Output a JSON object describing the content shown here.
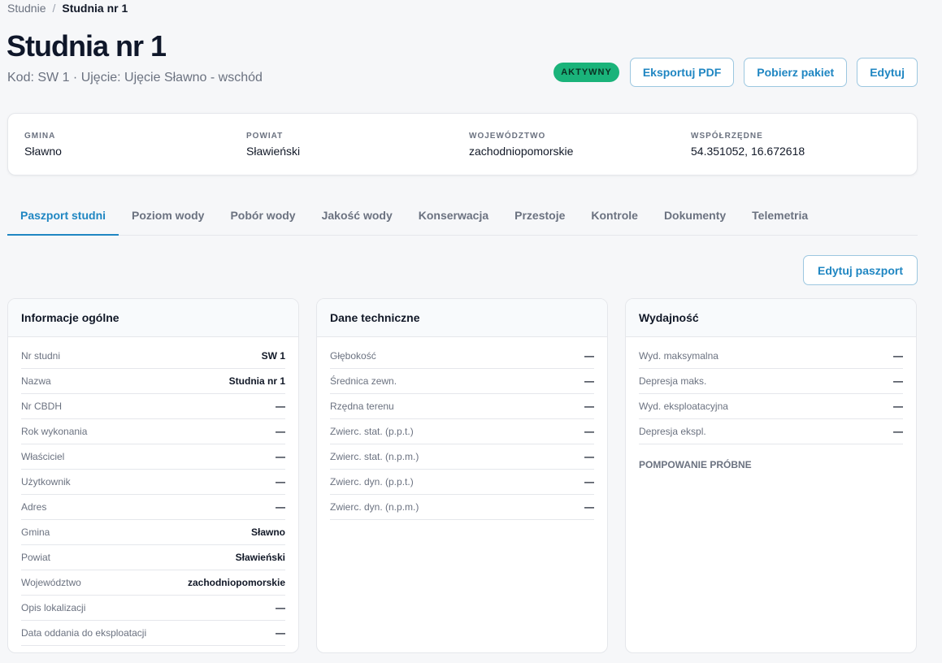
{
  "breadcrumb": {
    "parent": "Studnie",
    "separator": "/",
    "current": "Studnia nr 1"
  },
  "header": {
    "title": "Studnia nr 1",
    "subtitle": "Kod: SW 1 · Ujęcie: Ujęcie Sławno - wschód",
    "status_badge": "AKTYWNY",
    "buttons": {
      "export_pdf": "Eksportuj PDF",
      "download_package": "Pobierz pakiet",
      "edit": "Edytuj"
    }
  },
  "location": [
    {
      "label": "GMINA",
      "value": "Sławno"
    },
    {
      "label": "POWIAT",
      "value": "Sławieński"
    },
    {
      "label": "WOJEWÓDZTWO",
      "value": "zachodniopomorskie"
    },
    {
      "label": "WSPÓŁRZĘDNE",
      "value": "54.351052, 16.672618"
    }
  ],
  "tabs": [
    "Paszport studni",
    "Poziom wody",
    "Pobór wody",
    "Jakość wody",
    "Konserwacja",
    "Przestoje",
    "Kontrole",
    "Dokumenty",
    "Telemetria"
  ],
  "edit_passport_label": "Edytuj paszport",
  "panels": {
    "general": {
      "title": "Informacje ogólne",
      "rows": [
        {
          "k": "Nr studni",
          "v": "SW 1"
        },
        {
          "k": "Nazwa",
          "v": "Studnia nr 1"
        },
        {
          "k": "Nr CBDH",
          "v": "—"
        },
        {
          "k": "Rok wykonania",
          "v": "—"
        },
        {
          "k": "Właściciel",
          "v": "—"
        },
        {
          "k": "Użytkownik",
          "v": "—"
        },
        {
          "k": "Adres",
          "v": "—"
        },
        {
          "k": "Gmina",
          "v": "Sławno"
        },
        {
          "k": "Powiat",
          "v": "Sławieński"
        },
        {
          "k": "Województwo",
          "v": "zachodniopomorskie"
        },
        {
          "k": "Opis lokalizacji",
          "v": "—"
        },
        {
          "k": "Data oddania do eksploatacji",
          "v": "—"
        }
      ]
    },
    "technical": {
      "title": "Dane techniczne",
      "rows": [
        {
          "k": "Głębokość",
          "v": "—"
        },
        {
          "k": "Średnica zewn.",
          "v": "—"
        },
        {
          "k": "Rzędna terenu",
          "v": "—"
        },
        {
          "k": "Zwierc. stat. (p.p.t.)",
          "v": "—"
        },
        {
          "k": "Zwierc. stat. (n.p.m.)",
          "v": "—"
        },
        {
          "k": "Zwierc. dyn. (p.p.t.)",
          "v": "—"
        },
        {
          "k": "Zwierc. dyn. (n.p.m.)",
          "v": "—"
        }
      ]
    },
    "efficiency": {
      "title": "Wydajność",
      "rows": [
        {
          "k": "Wyd. maksymalna",
          "v": "—"
        },
        {
          "k": "Depresja maks.",
          "v": "—"
        },
        {
          "k": "Wyd. eksploatacyjna",
          "v": "—"
        },
        {
          "k": "Depresja ekspl.",
          "v": "—"
        }
      ],
      "section_label": "POMPOWANIE PRÓBNE"
    }
  }
}
